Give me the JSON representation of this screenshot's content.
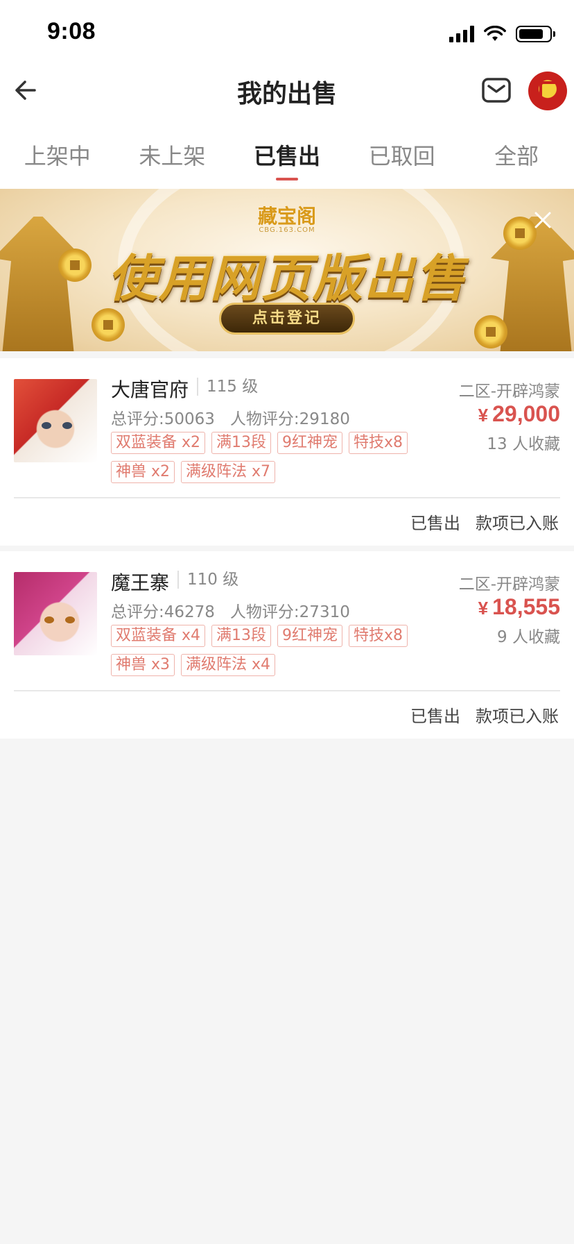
{
  "status_bar": {
    "time": "9:08"
  },
  "nav": {
    "title": "我的出售"
  },
  "tabs": [
    {
      "label": "上架中",
      "active": false
    },
    {
      "label": "未上架",
      "active": false
    },
    {
      "label": "已售出",
      "active": true
    },
    {
      "label": "已取回",
      "active": false
    },
    {
      "label": "全部",
      "active": false
    }
  ],
  "banner": {
    "logo_text": "藏宝阁",
    "logo_sub": "CBG.163.COM",
    "headline": "使用网页版出售",
    "button_label": "点击登记"
  },
  "listings": [
    {
      "name": "大唐官府",
      "level": "115 级",
      "total_score": "总评分:50063",
      "char_score": "人物评分:29180",
      "tags": [
        "双蓝装备 x2",
        "满13段",
        "9红神宠",
        "特技x8",
        "神兽 x2",
        "满级阵法 x7"
      ],
      "server": "二区-开辟鸿蒙",
      "currency": "¥",
      "price": "29,000",
      "favorites": "13 人收藏",
      "status": "已售出",
      "payment_status": "款项已入账"
    },
    {
      "name": "魔王寨",
      "level": "110 级",
      "total_score": "总评分:46278",
      "char_score": "人物评分:27310",
      "tags": [
        "双蓝装备 x4",
        "满13段",
        "9红神宠",
        "特技x8",
        "神兽 x3",
        "满级阵法 x4"
      ],
      "server": "二区-开辟鸿蒙",
      "currency": "¥",
      "price": "18,555",
      "favorites": "9 人收藏",
      "status": "已售出",
      "payment_status": "款项已入账"
    }
  ],
  "colors": {
    "accent": "#d9534f",
    "tag_text": "#e07b6f",
    "tag_border": "#efb3ab",
    "background": "#f5f5f5"
  },
  "icons": {
    "back": "arrow-left-icon",
    "mail": "mail-icon",
    "close": "close-icon"
  }
}
